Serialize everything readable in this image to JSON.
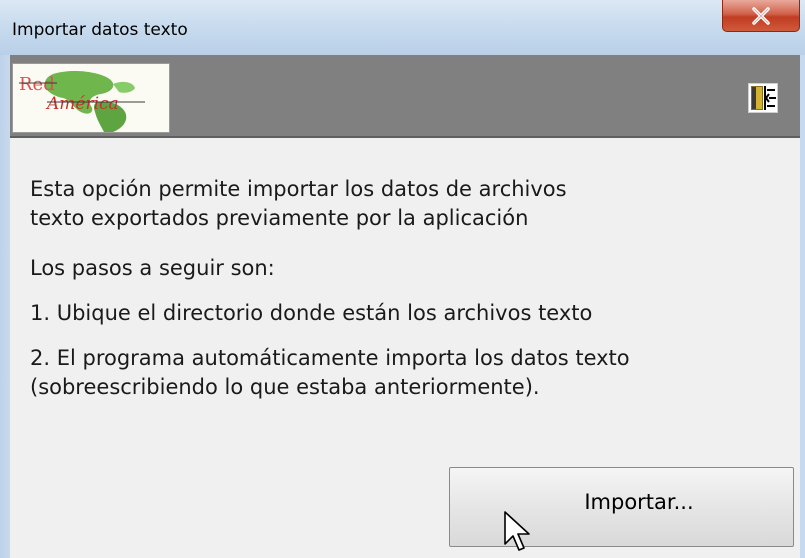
{
  "window": {
    "title": "Importar datos texto",
    "close_icon": "close-icon"
  },
  "toolbar": {
    "logo_text_line1": "Red",
    "logo_text_line2": "América",
    "exit_icon": "exit-door-icon"
  },
  "content": {
    "intro_line1": "Esta opción permite importar los datos de archivos",
    "intro_line2": "texto exportados previamente por la aplicación",
    "steps_heading": "Los pasos a seguir son:",
    "step1": "1. Ubique el directorio donde están los archivos texto",
    "step2_line1": "2. El programa automáticamente importa los datos texto",
    "step2_line2": "(sobreescribiendo lo que estaba anteriormente)."
  },
  "actions": {
    "import_label": "Importar..."
  },
  "colors": {
    "toolbar_bg": "#808080",
    "close_red": "#c13d22",
    "titlebar_blue": "#c9dcef"
  }
}
